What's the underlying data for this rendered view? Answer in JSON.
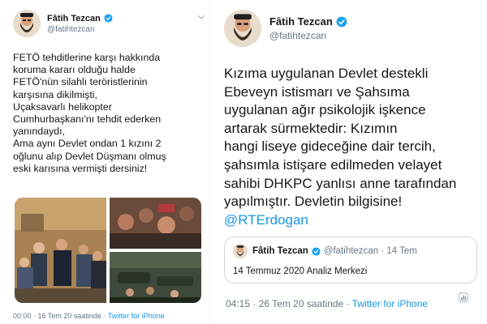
{
  "left_tweet": {
    "display_name": "Fâtih Tezcan",
    "handle": "@fatihtezcan",
    "text": "FETÖ tehditlerine karşı hakkında\nkoruma kararı olduğu halde\nFETÖ'nün silahlı teröristlerinin\nkarşısına dikilmişti,\nUçaksavarlı helikopter\nCumhurbaşkanı'nı tehdit ederken\nyanındaydı,\nAma aynı Devlet ondan 1 kızını 2\noğlunu alıp Devlet Düşmanı olmuş\neski karısına vermişti dersiniz!",
    "time": "00:00 · 16 Tem 20 saatinde ·",
    "app": "Twitter for iPhone",
    "icons": [
      "verified-badge-icon",
      "chevron-down-icon"
    ]
  },
  "right_tweet": {
    "display_name": "Fâtih Tezcan",
    "handle": "@fatihtezcan",
    "text": "Kızıma uygulanan Devlet destekli\nEbeveyn istismarı ve Şahsıma\nuygulanan ağır psikolojik işkence\nartarak sürmektedir: Kızımın\nhangi liseye gideceğine dair tercih,\nşahsımla istişare edilmeden velayet\nsahibi DHKPC yanlısı anne tarafından\nyapılmıştır. Devletin bilgisine!",
    "mention": "@RTErdogan",
    "time": "04:15 · 26 Tem 20 saatinde ·",
    "app": "Twitter for iPhone",
    "quote": {
      "display_name": "Fâtih Tezcan",
      "handle": "@fatihtezcan · 14 Tem",
      "text": "14 Temmuz 2020 Analiz Merkezi"
    },
    "icons": [
      "verified-badge-icon",
      "analytics-icon"
    ]
  },
  "colors": {
    "link": "#1b95e0",
    "verified": "#1da1f2",
    "muted": "#657786",
    "text": "#14171a"
  }
}
